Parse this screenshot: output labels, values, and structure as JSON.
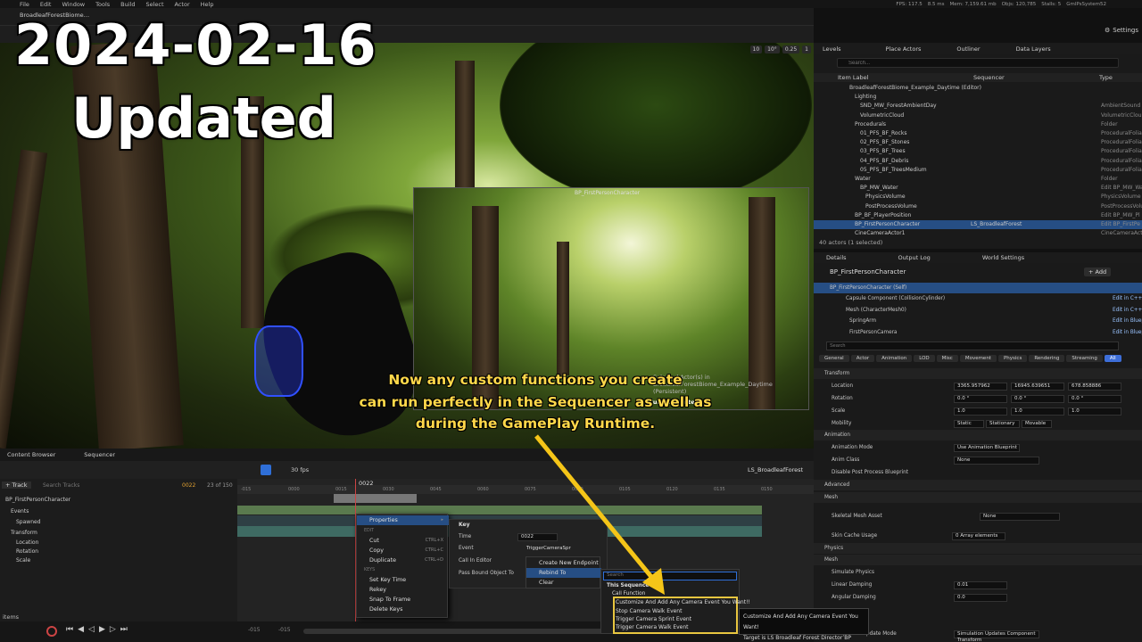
{
  "menu": [
    "File",
    "Edit",
    "Window",
    "Tools",
    "Build",
    "Select",
    "Actor",
    "Help"
  ],
  "project_tab": "BroadleafForestBiome…",
  "stats": {
    "fps": "FPS: 117.5",
    "ms": "8.5 ms",
    "mem": "Mem: 7,159.61 mb",
    "objs": "Objs: 120,785",
    "stalls": "Stalls: 5",
    "system": "GmlPsSystem52"
  },
  "settings_label": "Settings",
  "overlay": {
    "date": "2024-02-16",
    "updated": "Updated",
    "caption_lines": [
      "Now any custom functions you create",
      "can run perfectly in the Sequencer as well as",
      "during the GamePlay Runtime."
    ]
  },
  "viewport": {
    "icon_labels": [
      "10",
      "10°",
      "0.25",
      "1"
    ],
    "pip_label": "BP_FirstPersonCharacter",
    "pip_actor": "Selected Actor(s) in BroadleafForestBiome_Example_Daytime (Persistent)",
    "pip_context": "Current Context"
  },
  "right_tabs": [
    "Levels",
    "Place Actors",
    "Outliner",
    "Data Layers"
  ],
  "outliner": {
    "search_placeholder": "Search...",
    "col_label": "Item Label",
    "col_seq": "Sequencer",
    "col_type": "Type",
    "rows": [
      {
        "label": "BroadleafForestBiome_Example_Daytime (Editor)",
        "type": "",
        "indent": 0,
        "sel": false
      },
      {
        "label": "Lighting",
        "type": "",
        "indent": 1,
        "sel": false
      },
      {
        "label": "SND_MW_ForestAmbientDay",
        "type": "AmbientSound",
        "indent": 2,
        "sel": false
      },
      {
        "label": "VolumetricCloud",
        "type": "VolumetricClou",
        "indent": 2,
        "sel": false
      },
      {
        "label": "Procedurals",
        "type": "Folder",
        "indent": 1,
        "sel": false
      },
      {
        "label": "01_PFS_BF_Rocks",
        "type": "ProceduralFolia",
        "indent": 2,
        "sel": false
      },
      {
        "label": "02_PFS_BF_Stones",
        "type": "ProceduralFolia",
        "indent": 2,
        "sel": false
      },
      {
        "label": "03_PFS_BF_Trees",
        "type": "ProceduralFolia",
        "indent": 2,
        "sel": false
      },
      {
        "label": "04_PFS_BF_Debris",
        "type": "ProceduralFolia",
        "indent": 2,
        "sel": false
      },
      {
        "label": "05_PFS_BF_TreesMedium",
        "type": "ProceduralFolia",
        "indent": 2,
        "sel": false
      },
      {
        "label": "Water",
        "type": "Folder",
        "indent": 1,
        "sel": false
      },
      {
        "label": "BP_MW_Water",
        "type": "Edit BP_MW_Wat",
        "indent": 2,
        "sel": false
      },
      {
        "label": "PhysicsVolume",
        "type": "PhysicsVolume",
        "indent": 3,
        "sel": false
      },
      {
        "label": "PostProcessVolume",
        "type": "PostProcessVolu",
        "indent": 3,
        "sel": false
      },
      {
        "label": "BP_BF_PlayerPosition",
        "type": "Edit BP_MW_Pl",
        "indent": 1,
        "sel": false
      },
      {
        "label": "BP_FirstPersonCharacter",
        "seq": "LS_BroadleafForest",
        "type": "Edit BP_FirstPe",
        "indent": 1,
        "sel": true
      },
      {
        "label": "CineCameraActor1",
        "type": "CineCameraActo",
        "indent": 1,
        "sel": false
      }
    ],
    "count": "40 actors (1 selected)"
  },
  "details": {
    "tabs": [
      "Details",
      "Output Log",
      "World Settings"
    ],
    "actor": "BP_FirstPersonCharacter",
    "add_label": "+ Add",
    "components": [
      {
        "name": "BP_FirstPersonCharacter (Self)",
        "edit": ""
      },
      {
        "name": "Capsule Component (CollisionCylinder)",
        "edit": "Edit in C++"
      },
      {
        "name": "Mesh (CharacterMesh0)",
        "edit": "Edit in C++"
      },
      {
        "name": "SpringArm",
        "edit": "Edit in Blueprint"
      },
      {
        "name": "FirstPersonCamera",
        "edit": "Edit in Blueprint"
      }
    ],
    "search_placeholder": "Search",
    "cat_tabs": [
      "General",
      "Actor",
      "Animation",
      "LOD",
      "Misc",
      "Movement",
      "Physics",
      "Rendering",
      "Streaming",
      "All"
    ],
    "transform": "Transform",
    "location": "Location",
    "loc": [
      "3365.957962",
      "16945.639651",
      "678.858886"
    ],
    "rotation": "Rotation",
    "rot": [
      "0.0 °",
      "0.0 °",
      "0.0 °"
    ],
    "scale": "Scale",
    "scl": [
      "1.0",
      "1.0",
      "1.0"
    ],
    "mobility": "Mobility",
    "mob_opts": [
      "Static",
      "Stationary",
      "Movable"
    ],
    "animation": "Animation",
    "anim_mode": "Animation Mode",
    "anim_mode_val": "Use Animation Blueprint",
    "anim_class": "Anim Class",
    "anim_class_val": "None",
    "disable_pp": "Disable Post Process Blueprint",
    "advanced": "Advanced",
    "mesh": "Mesh",
    "skel_mesh": "Skeletal Mesh Asset",
    "none": "None",
    "skin_cache": "Skin Cache Usage",
    "array_elems": "0 Array elements",
    "physics": "Physics",
    "mesh2": "Mesh",
    "sim_phys": "Simulate Physics",
    "lin_damp": "Linear Damping",
    "lin_val": "0.01",
    "ang_damp": "Angular Damping",
    "ang_val": "0.0",
    "comp_update": "Component Update Mode",
    "comp_update_val": "Simulation Updates Component Transform"
  },
  "sequencer": {
    "tabs": [
      "Content Browser",
      "Sequencer"
    ],
    "fps": "30 fps",
    "sequence": "LS_BroadleafForest",
    "track_btn": "+ Track",
    "search_tracks": "Search Tracks",
    "frame": "0022",
    "frame_of": "23 of 150",
    "ruler": [
      "-015",
      "0000",
      "0015",
      "0030",
      "0045",
      "0060",
      "0075",
      "0090",
      "0105",
      "0120",
      "0135",
      "0150"
    ],
    "tracks": [
      "BP_FirstPersonCharacter",
      "Events",
      "Spawned",
      "Transform",
      "Location",
      "Rotation",
      "Scale"
    ],
    "items": "items",
    "range": [
      "-015",
      "-015"
    ]
  },
  "context_menu": {
    "properties": "Properties",
    "edit_grp": "EDIT",
    "cut": "Cut",
    "cut_sc": "CTRL+X",
    "copy": "Copy",
    "copy_sc": "CTRL+C",
    "dup": "Duplicate",
    "dup_sc": "CTRL+D",
    "keys_grp": "KEYS",
    "set_key_time": "Set Key Time",
    "rekey": "Rekey",
    "snap": "Snap To Frame",
    "delete_keys": "Delete Keys"
  },
  "key_panel": {
    "title": "Key",
    "time": "Time",
    "time_val": "0022",
    "event": "Event",
    "event_val": "TriggerCameraSpr",
    "call_editor": "Call In Editor",
    "pass_bound": "Pass Bound Object To"
  },
  "submenu": {
    "create": "Create New Endpoint",
    "rebind": "Rebind To",
    "clear": "Clear"
  },
  "func_panel": {
    "search": "Search",
    "this_seq": "This Sequence",
    "call_fn": "Call Function",
    "items": [
      "Customize And Add Any Camera Event You Want!!",
      "Stop Camera Walk Event",
      "Trigger Camera Sprint Event",
      "Trigger Camera Walk Event"
    ]
  },
  "tooltip": {
    "line1": "Customize And Add Any Camera Event You Want!",
    "line2": "Target is LS Broadleaf Forest Director BP"
  },
  "colors": {
    "accent": "#264e84",
    "caption": "#ffd84a",
    "highlight": "#e8c640"
  }
}
